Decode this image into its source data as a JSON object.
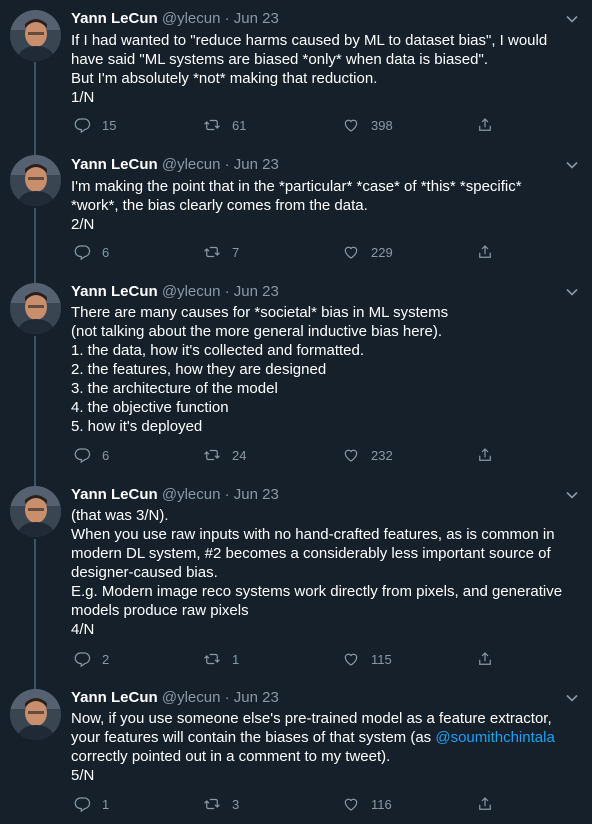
{
  "author": {
    "name": "Yann LeCun",
    "handle": "@ylecun",
    "separator": "·"
  },
  "tweets": [
    {
      "date": "Jun 23",
      "lines": [
        "If I had wanted to \"reduce harms caused by ML to dataset bias\", I would",
        "have said \"ML systems are biased *only* when data is biased\".",
        "But I'm absolutely *not* making that reduction.",
        "1/N"
      ],
      "replies": "15",
      "retweets": "61",
      "likes": "398"
    },
    {
      "date": "Jun 23",
      "lines": [
        "I'm making the point that in the *particular* *case* of *this* *specific*",
        "*work*, the bias clearly comes from the data.",
        "2/N"
      ],
      "replies": "6",
      "retweets": "7",
      "likes": "229"
    },
    {
      "date": "Jun 23",
      "lines": [
        "There are many causes for *societal* bias in ML systems",
        "(not talking about the more general inductive bias here).",
        "1. the data, how it's collected and formatted.",
        "2. the features, how they are designed",
        "3. the architecture of the model",
        "4. the objective function",
        "5. how it's deployed"
      ],
      "replies": "6",
      "retweets": "24",
      "likes": "232"
    },
    {
      "date": "Jun 23",
      "lines": [
        "(that was 3/N).",
        "When you use raw inputs with no hand-crafted features, as is common in",
        "modern DL system, #2 becomes a considerably less important source of",
        "designer-caused bias.",
        "E.g. Modern image reco systems work directly from pixels, and generative",
        "models produce raw pixels",
        "4/N"
      ],
      "replies": "2",
      "retweets": "1",
      "likes": "115"
    },
    {
      "date": "Jun 23",
      "lines": [
        "Now, if you use someone else's pre-trained model as a feature extractor,",
        "your features will contain the biases of that system (as ",
        "correctly pointed out in a comment to my tweet).",
        "5/N"
      ],
      "mention": "@soumithchintala",
      "replies": "1",
      "retweets": "3",
      "likes": "116"
    }
  ],
  "colors": {
    "background": "#15202b",
    "text": "#ffffff",
    "muted": "#8899a6",
    "link": "#1da1f2",
    "thread": "#3d5466"
  },
  "icons": {
    "reply": "reply-icon",
    "retweet": "retweet-icon",
    "like": "heart-icon",
    "share": "share-icon",
    "menu": "chevron-down-icon"
  }
}
